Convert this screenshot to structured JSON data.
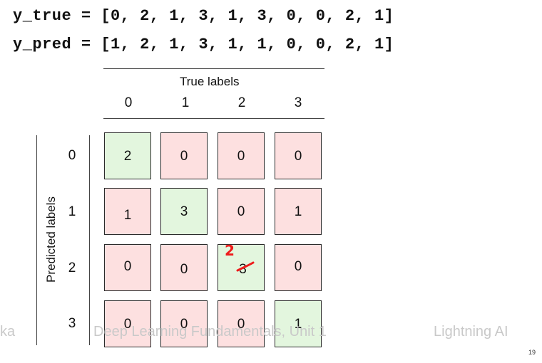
{
  "code": {
    "y_true": "y_true = [0, 2, 1, 3, 1, 3, 0, 0, 2, 1]",
    "y_pred": "y_pred = [1, 2, 1, 3, 1, 1, 0, 0, 2, 1]"
  },
  "matrix": {
    "true_axis_title": "True labels",
    "pred_axis_title": "Predicted labels",
    "col_labels": [
      "0",
      "1",
      "2",
      "3"
    ],
    "row_labels": [
      "0",
      "1",
      "2",
      "3"
    ],
    "cells": [
      [
        "2",
        "0",
        "0",
        "0"
      ],
      [
        "1",
        "3",
        "0",
        "1"
      ],
      [
        "0",
        "0",
        "3",
        "0"
      ],
      [
        "0",
        "0",
        "0",
        "1"
      ]
    ],
    "correction": {
      "original": "3",
      "corrected": "2",
      "annotation_color": "#ee1c1c"
    },
    "colors": {
      "correct": "#e3f6de",
      "incorrect": "#fde0e0"
    }
  },
  "footer": {
    "left_fragment": "ka",
    "course": "Deep Learning Fundamentals, Unit 1",
    "brand": "Lightning AI",
    "page_number": "19"
  }
}
